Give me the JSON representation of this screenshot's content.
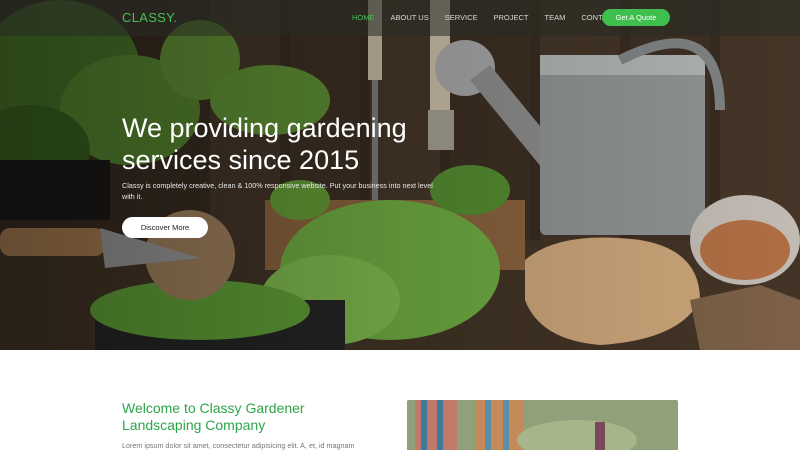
{
  "brand": {
    "name": "CLASSY."
  },
  "nav": {
    "items": [
      {
        "label": "HOME",
        "active": true
      },
      {
        "label": "ABOUT US",
        "active": false
      },
      {
        "label": "SERVICE",
        "active": false
      },
      {
        "label": "PROJECT",
        "active": false
      },
      {
        "label": "TEAM",
        "active": false
      },
      {
        "label": "CONTACT",
        "active": false
      }
    ],
    "cta_label": "Get A Quote"
  },
  "hero": {
    "title": "We providing gardening services since 2015",
    "text": "Classy is completely creative, clean & 100% responsive website. Put your business into next level with it.",
    "button_label": "Discover More"
  },
  "welcome": {
    "title": "Welcome to Classy Gardener Landscaping Company",
    "text": "Lorem ipsum dolor sit amet, consectetur adipisicing elit. A, et, id magnam"
  },
  "colors": {
    "accent": "#3fbf4e",
    "heading_green": "#2ea44b",
    "nav_active": "#49c05a"
  }
}
